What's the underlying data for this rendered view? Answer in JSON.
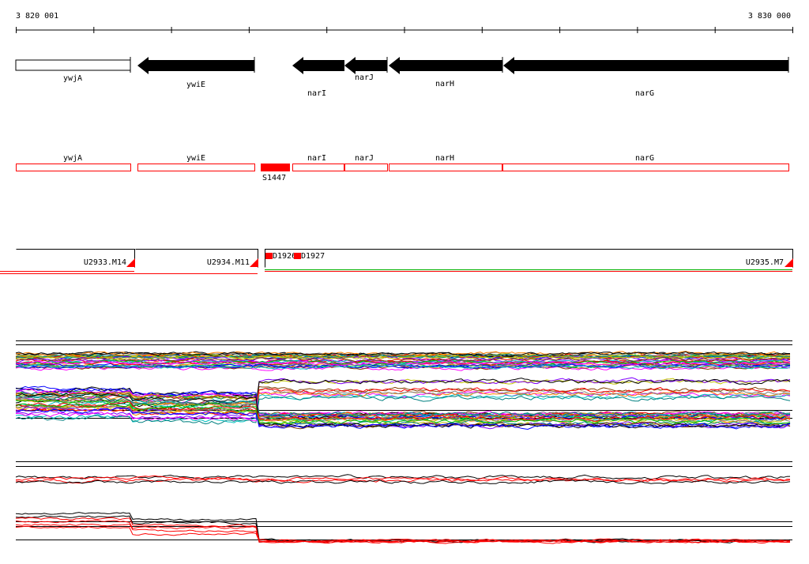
{
  "ruler": {
    "start_label": "3 820 001",
    "end_label": "3 830 000"
  },
  "gene_track": [
    {
      "name": "ywjA",
      "strand": "+",
      "filled": false
    },
    {
      "name": "ywiE",
      "strand": "-",
      "filled": true
    },
    {
      "name": "narI",
      "strand": "-",
      "filled": true
    },
    {
      "name": "narJ",
      "strand": "-",
      "filled": true
    },
    {
      "name": "narH",
      "strand": "-",
      "filled": true
    },
    {
      "name": "narG",
      "strand": "-",
      "filled": true
    }
  ],
  "annotation_track": {
    "genes": [
      "ywjA",
      "ywiE",
      "narI",
      "narJ",
      "narH",
      "narG"
    ],
    "feature_label": "S1447"
  },
  "segment_track": {
    "segments": [
      "U2933.M14",
      "U2934.M11",
      "U2935.M7"
    ],
    "markers": [
      "D1926",
      "D1927"
    ]
  },
  "colors": {
    "gene_fill": "#000000",
    "annotation": "#ff0000",
    "line_palette": [
      "#ff0000",
      "#00c000",
      "#0000ff",
      "#ff00ff",
      "#00c0c0",
      "#c0c000",
      "#ff8000",
      "#8000ff",
      "#008080",
      "#804000",
      "#000000",
      "#808080"
    ]
  }
}
